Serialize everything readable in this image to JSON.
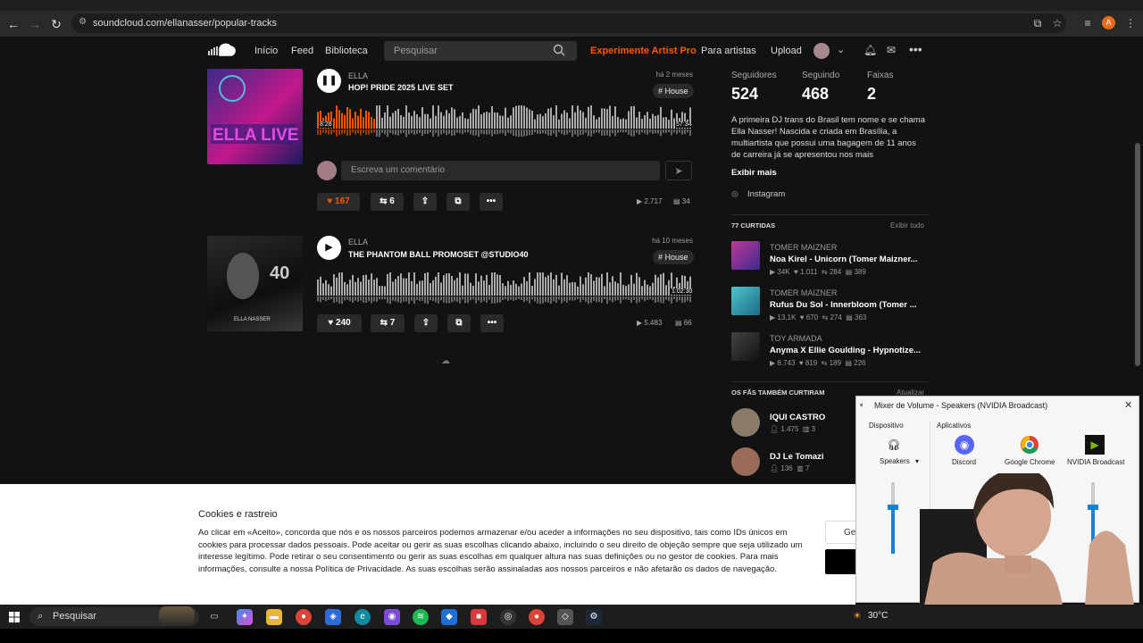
{
  "browser": {
    "url": "soundcloud.com/ellanasser/popular-tracks",
    "profile_initial": "A"
  },
  "header": {
    "nav": [
      "Início",
      "Feed",
      "Biblioteca"
    ],
    "search_placeholder": "Pesquisar",
    "pro": "Experimente Artist Pro",
    "artists": "Para artistas",
    "upload": "Upload"
  },
  "tracks": [
    {
      "user": "ELLA",
      "title": "HOP! PRIDE 2025 LIVE SET",
      "date": "há 2 meses",
      "tag": "# House",
      "time_start": "8:28",
      "time_end": "57:34",
      "progress": 0.15,
      "likes": "167",
      "reposts": "6",
      "plays": "2.717",
      "comments": "34",
      "playing": true
    },
    {
      "user": "ELLA",
      "title": "THE PHANTOM BALL PROMOSET @STUDIO40",
      "date": "há 10 meses",
      "tag": "# House",
      "time_end": "1:02:30",
      "progress": 0,
      "likes": "240",
      "reposts": "7",
      "plays": "5.483",
      "comments": "66",
      "playing": false
    }
  ],
  "comment_placeholder": "Escreva um comentário",
  "stats": {
    "followers_label": "Seguidores",
    "followers": "524",
    "following_label": "Seguindo",
    "following": "468",
    "tracks_label": "Faixas",
    "tracks": "2"
  },
  "bio": "A primeira DJ trans do Brasil tem nome e se chama Ella Nasser! Nascida e criada em Brasília, a multiartista que possui uma bagagem de 11 anos de carreira já se apresentou nos mais",
  "show_more": "Exibir mais",
  "instagram": "Instagram",
  "likes_section": {
    "title": "77 CURTIDAS",
    "see_all": "Exibir tudo",
    "items": [
      {
        "user": "TOMER MAIZNER",
        "title": "Noa Kirel - Unicorn (Tomer Maizner...",
        "plays": "34K",
        "likes": "1.011",
        "reposts": "284",
        "comments": "389",
        "color": "#c03a9a"
      },
      {
        "user": "TOMER MAIZNER",
        "title": "Rufus Du Sol - Innerbloom (Tomer ...",
        "plays": "13,1K",
        "likes": "670",
        "reposts": "274",
        "comments": "363",
        "color": "#4fc3c8"
      },
      {
        "user": "TOY ARMADA",
        "title": "Anyma X Ellie Goulding - Hypnotize...",
        "plays": "8.743",
        "likes": "819",
        "reposts": "189",
        "comments": "226",
        "color": "#2a2a2a"
      }
    ]
  },
  "fans_section": {
    "title": "OS FÃS TAMBÉM CURTIRAM",
    "refresh": "Atualizar",
    "items": [
      {
        "name": "IQUI CASTRO",
        "followers": "1.475",
        "tracks": "3"
      },
      {
        "name": "DJ Le Tomazi",
        "followers": "136",
        "tracks": "7"
      }
    ]
  },
  "cookie": {
    "title": "Cookies e rastreio",
    "text": "Ao clicar em «Aceito», concorda que nós e os nossos parceiros podemos armazenar e/ou aceder a informações no seu dispositivo, tais como IDs únicos em cookies para processar dados pessoais. Pode aceitar ou gerir as suas escolhas clicando abaixo, incluindo o seu direito de objeção sempre que seja utilizado um interesse legítimo. Pode retirar o seu consentimento ou gerir as suas escolhas em qualquer altura nas suas definições ou no gestor de cookies. Para mais informações, consulte a nossa Política de Privacidade. As suas escolhas serão assinaladas aos nossos parceiros e não afetarão os dados de navegação.",
    "manage": "Ger"
  },
  "mixer": {
    "title": "Mixer de Volume - Speakers (NVIDIA Broadcast)",
    "device_label": "Dispositivo",
    "apps_label": "Aplicativos",
    "apps": [
      "Speakers",
      "Discord",
      "Google Chrome",
      "NVIDIA Broadcast"
    ]
  },
  "taskbar": {
    "search": "Pesquisar",
    "temp": "30°C"
  }
}
